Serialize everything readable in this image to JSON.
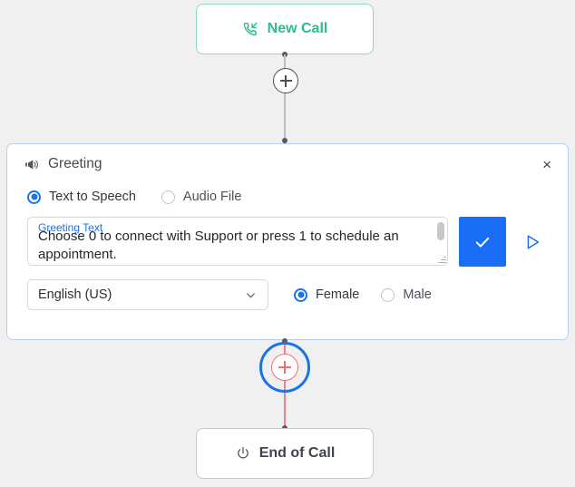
{
  "canvas": {
    "background": "#f0f0f0"
  },
  "nodes": {
    "new_call": {
      "label": "New Call",
      "icon": "incoming-call-icon",
      "color": "#2bbd8c",
      "border_color": "#8fd8c0"
    },
    "end_call": {
      "label": "End of Call",
      "icon": "power-icon",
      "color": "#3d434b",
      "border_color": "#c8c8c8"
    }
  },
  "connectors": {
    "add_node_top": {
      "label": "+",
      "name": "add-step-button-top",
      "color": "#4a4f56"
    },
    "add_node_bottom": {
      "label": "+",
      "name": "add-step-button-bottom",
      "color": "#f07070",
      "selection_ring_color": "#1a73e8",
      "selected": "selected"
    }
  },
  "panel": {
    "title": "Greeting",
    "icon": "announcement-icon",
    "close_label": "×",
    "border_color": "#b9cdf5",
    "source_type": {
      "options": [
        {
          "label": "Text to Speech",
          "selected": true
        },
        {
          "label": "Audio File",
          "selected": false
        }
      ]
    },
    "greeting_text": {
      "label": "Greeting Text",
      "value": "Choose 0 to connect with Support or press 1 to schedule an appointment.",
      "placeholder": "Greeting Text",
      "label_color": "#1a73e8"
    },
    "confirm_button": {
      "label": "✓",
      "icon": "check-icon",
      "color": "#1a6ef5"
    },
    "play_button": {
      "label": "▷",
      "icon": "play-icon",
      "color": "#1a6ef5"
    },
    "language": {
      "selected": "English (US)",
      "options": [
        "English (US)"
      ]
    },
    "voice_gender": {
      "options": [
        {
          "label": "Female",
          "selected": true
        },
        {
          "label": "Male",
          "selected": false
        }
      ]
    }
  }
}
